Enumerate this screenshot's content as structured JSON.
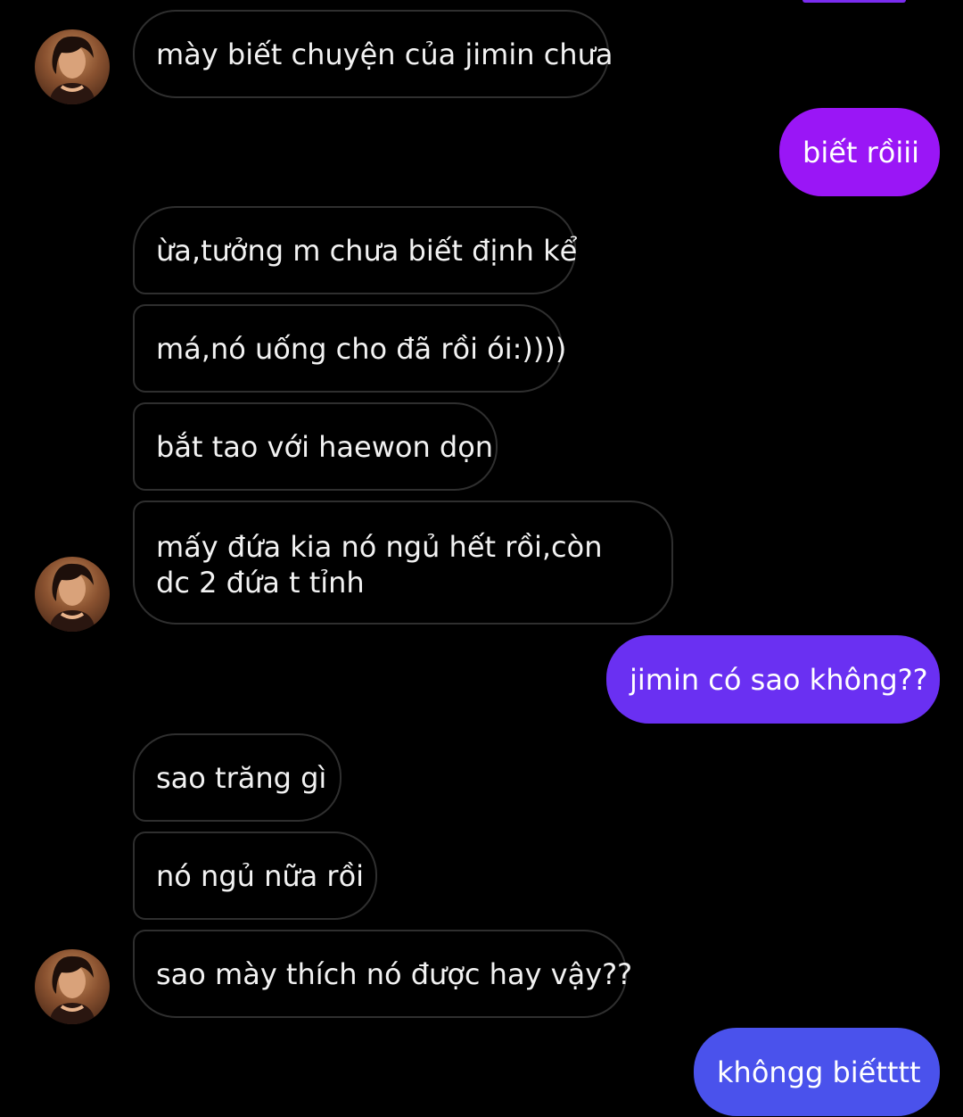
{
  "contact": {
    "avatar_icon": "profile-photo-icon"
  },
  "colors": {
    "background": "#000000",
    "incoming_border": "#2f2f2f",
    "incoming_text": "#f2f2f2",
    "outgoing_gradient_top": "#9a16f6",
    "outgoing_gradient_mid": "#6a30f2",
    "outgoing_gradient_bottom": "#4a52ec"
  },
  "messages": [
    {
      "direction": "incoming",
      "text": "mày biết chuyện của jimin chưa"
    },
    {
      "direction": "outgoing",
      "text": "biết rồiii"
    },
    {
      "direction": "incoming",
      "text": "ừa,tưởng m chưa biết định kể"
    },
    {
      "direction": "incoming",
      "text": "má,nó uống cho đã rồi ói:))))"
    },
    {
      "direction": "incoming",
      "text": "bắt tao với haewon dọn"
    },
    {
      "direction": "incoming",
      "text": "mấy đứa kia nó ngủ hết rồi,còn dc 2 đứa t tỉnh"
    },
    {
      "direction": "outgoing",
      "text": "jimin có sao không??"
    },
    {
      "direction": "incoming",
      "text": "sao trăng gì"
    },
    {
      "direction": "incoming",
      "text": "nó ngủ nữa rồi"
    },
    {
      "direction": "incoming",
      "text": "sao mày thích nó được hay vậy??"
    },
    {
      "direction": "outgoing",
      "text": "khôngg biếtttt"
    }
  ]
}
